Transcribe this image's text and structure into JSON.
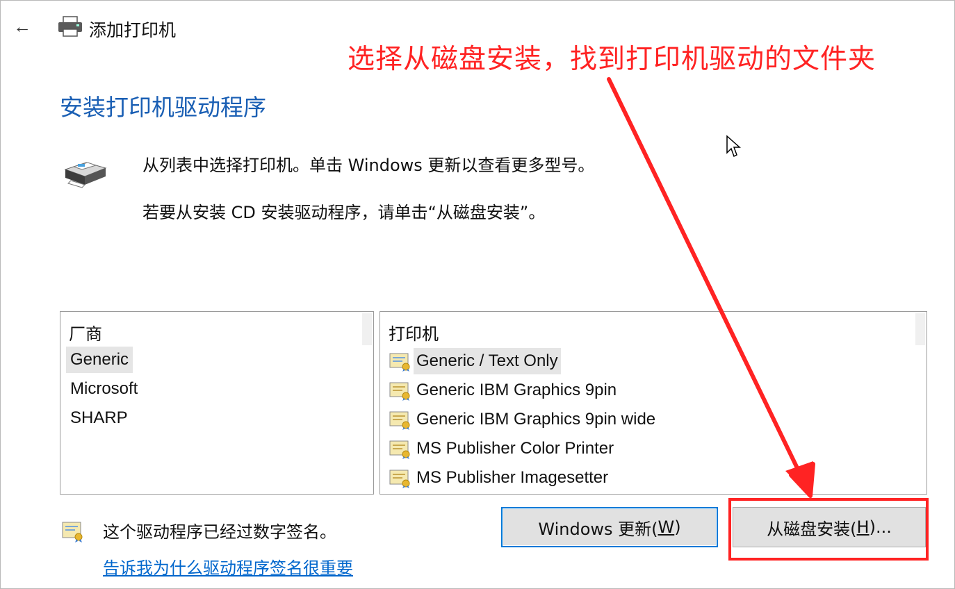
{
  "window": {
    "title": "添加打印机",
    "back_icon": "back-arrow-icon"
  },
  "annotation": {
    "text": "选择从磁盘安装，找到打印机驱动的文件夹",
    "color": "#ff2323"
  },
  "page": {
    "title": "安装打印机驱动程序",
    "title_color": "#1a5fb4",
    "description_line1": "从列表中选择打印机。单击 Windows 更新以查看更多型号。",
    "description_line2": "若要从安装 CD 安装驱动程序，请单击“从磁盘安装”。"
  },
  "manufacturers": {
    "header": "厂商",
    "items": [
      {
        "label": "Generic",
        "selected": true
      },
      {
        "label": "Microsoft",
        "selected": false
      },
      {
        "label": "SHARP",
        "selected": false
      }
    ]
  },
  "printers": {
    "header": "打印机",
    "items": [
      {
        "label": "Generic / Text Only",
        "selected": true
      },
      {
        "label": "Generic IBM Graphics 9pin",
        "selected": false
      },
      {
        "label": "Generic IBM Graphics 9pin wide",
        "selected": false
      },
      {
        "label": "MS Publisher Color Printer",
        "selected": false
      },
      {
        "label": "MS Publisher Imagesetter",
        "selected": false
      }
    ]
  },
  "footer": {
    "signed_text": "这个驱动程序已经过数字签名。",
    "signing_link": "告诉我为什么驱动程序签名很重要"
  },
  "buttons": {
    "windows_update_prefix": "Windows 更新(",
    "windows_update_key": "W",
    "windows_update_suffix": ")",
    "have_disk_prefix": "从磁盘安装(",
    "have_disk_key": "H",
    "have_disk_suffix": ")..."
  }
}
